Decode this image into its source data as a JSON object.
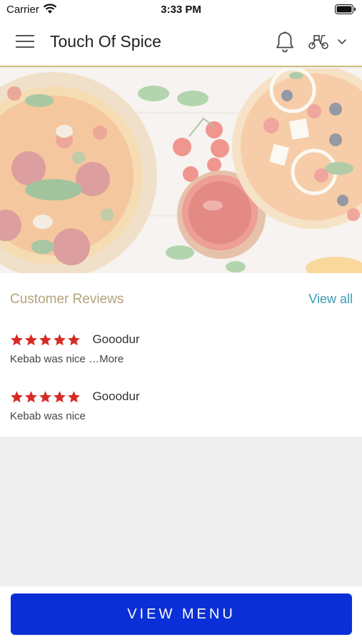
{
  "status_bar": {
    "carrier": "Carrier",
    "time": "3:33 PM"
  },
  "header": {
    "title": "Touch Of Spice",
    "icons": [
      "menu-icon",
      "bell-icon",
      "scooter-icon",
      "chevron-down-icon"
    ]
  },
  "banner": {
    "alt": "pizza-banner-image"
  },
  "reviews": {
    "title": "Customer Reviews",
    "view_all": "View all",
    "star_color": "#d62b25",
    "items": [
      {
        "rating": 5,
        "name": "Gooodur",
        "text": "Kebab was nice …",
        "more": "More"
      },
      {
        "rating": 5,
        "name": "Gooodur",
        "text": "Kebab was nice"
      }
    ]
  },
  "footer": {
    "view_menu": "VIEW MENU",
    "button_color": "#0a2fd6"
  }
}
